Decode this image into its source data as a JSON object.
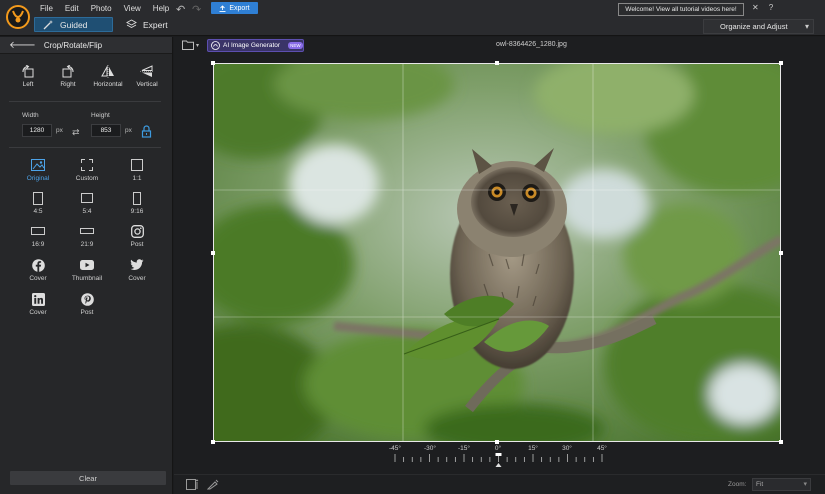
{
  "menu": [
    "File",
    "Edit",
    "Photo",
    "View",
    "Help"
  ],
  "modes": {
    "guided": "Guided",
    "expert": "Expert"
  },
  "toolbar": {
    "export": "Export",
    "undo_icon": "undo-icon",
    "redo_icon": "redo-icon"
  },
  "welcome_message": "Welcome! View all tutorial videos here!",
  "titlebar_icons": [
    "close-icon",
    "help-icon"
  ],
  "organize_dropdown": "Organize and Adjust",
  "panel": {
    "title": "Crop/Rotate/Flip",
    "rotate_buttons": [
      "Left",
      "Right",
      "Horizontal",
      "Vertical"
    ],
    "width_label": "Width",
    "height_label": "Height",
    "width_value": "1280",
    "height_value": "853",
    "unit": "px",
    "ratios": [
      {
        "label": "Original",
        "icon": "image-icon",
        "active": true
      },
      {
        "label": "Custom",
        "icon": "custom-crop-icon"
      },
      {
        "label": "1:1",
        "icon": "square-icon"
      },
      {
        "label": "4:5",
        "icon": "portrait-rect-icon"
      },
      {
        "label": "5:4",
        "icon": "landscape-rect-icon"
      },
      {
        "label": "9:16",
        "icon": "tall-rect-icon"
      },
      {
        "label": "16:9",
        "icon": "wide-rect-icon"
      },
      {
        "label": "21:9",
        "icon": "ultrawide-rect-icon"
      },
      {
        "label": "Post",
        "icon": "instagram-icon"
      },
      {
        "label": "Cover",
        "icon": "facebook-icon"
      },
      {
        "label": "Thumbnail",
        "icon": "youtube-icon"
      },
      {
        "label": "Cover",
        "icon": "twitter-icon"
      },
      {
        "label": "Cover",
        "icon": "linkedin-icon"
      },
      {
        "label": "Post",
        "icon": "pinterest-icon"
      }
    ],
    "clear": "Clear"
  },
  "canvas": {
    "ai_generator": "AI Image Generator",
    "ai_badge": "NEW",
    "filename": "owl-8364426_1280.jpg"
  },
  "ruler": {
    "labels": [
      "-45°",
      "-30°",
      "-15°",
      "0°",
      "15°",
      "30°",
      "45°"
    ],
    "value": 0
  },
  "zoom": {
    "label": "Zoom:",
    "value": "Fit"
  },
  "colors": {
    "accent": "#2f7fd4",
    "guided_bg": "#1f4f73",
    "ai_purple": "#3a3468",
    "active_ratio": "#4da3e8"
  }
}
